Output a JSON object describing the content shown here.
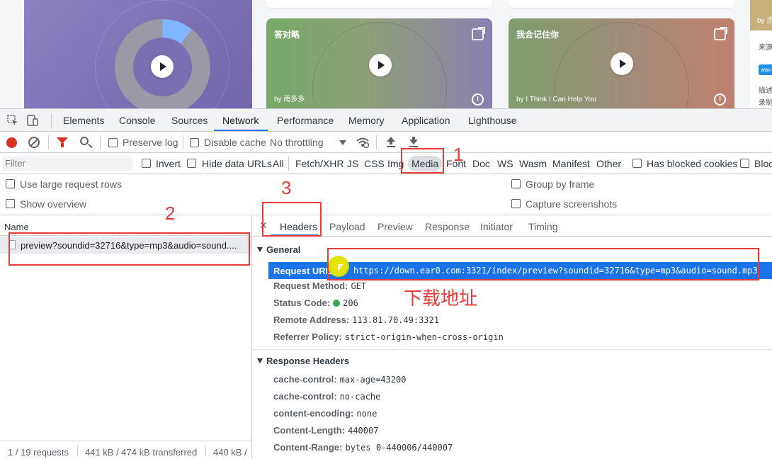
{
  "page": {
    "cards": [
      {
        "title": "",
        "author": ""
      },
      {
        "title": "答对略",
        "author": "by 雨多多"
      },
      {
        "title": "我会记住你",
        "author": "by I Think I Can Help You"
      }
    ],
    "side": {
      "top_text": "by 杰",
      "line1": "来源",
      "badge": "wav",
      "line2": "描述",
      "line3": "录制"
    }
  },
  "devtools": {
    "tabs": [
      "Elements",
      "Console",
      "Sources",
      "Network",
      "Performance",
      "Memory",
      "Application",
      "Lighthouse"
    ],
    "active_tab": "Network",
    "toolbar": {
      "preserve_log": "Preserve log",
      "disable_cache": "Disable cache",
      "throttling": "No throttling"
    },
    "filter": {
      "placeholder": "Filter",
      "invert": "Invert",
      "hide_data_urls": "Hide data URLs",
      "types": [
        "All",
        "Fetch/XHR",
        "JS",
        "CSS",
        "Img",
        "Media",
        "Font",
        "Doc",
        "WS",
        "Wasm",
        "Manifest",
        "Other"
      ],
      "active_type": "Media",
      "has_blocked_cookies": "Has blocked cookies",
      "blocked_requests": "Bloc"
    },
    "options": {
      "large_rows": "Use large request rows",
      "group_by_frame": "Group by frame",
      "show_overview": "Show overview",
      "capture_screenshots": "Capture screenshots"
    },
    "list": {
      "header": "Name",
      "rows": [
        "preview?soundid=32716&type=mp3&audio=sound...."
      ]
    },
    "status": {
      "requests": "1 / 19 requests",
      "transferred": "441 kB / 474 kB transferred",
      "resources": "440 kB /"
    },
    "detail_tabs": [
      "Headers",
      "Payload",
      "Preview",
      "Response",
      "Initiator",
      "Timing"
    ],
    "active_detail_tab": "Headers",
    "general": {
      "title": "General",
      "request_url_key": "Request URL:",
      "request_url": "https://down.ear0.com:3321/index/preview?soundid=32716&type=mp3&audio=sound.mp3",
      "request_method_key": "Request Method:",
      "request_method": "GET",
      "status_code_key": "Status Code:",
      "status_code": "206",
      "remote_address_key": "Remote Address:",
      "remote_address": "113.81.70.49:3321",
      "referrer_policy_key": "Referrer Policy:",
      "referrer_policy": "strict-origin-when-cross-origin"
    },
    "response_headers": {
      "title": "Response Headers",
      "items": [
        {
          "k": "cache-control:",
          "v": "max-age=43200"
        },
        {
          "k": "cache-control:",
          "v": "no-cache"
        },
        {
          "k": "content-encoding:",
          "v": "none"
        },
        {
          "k": "Content-Length:",
          "v": "440007"
        },
        {
          "k": "Content-Range:",
          "v": "bytes 0-440006/440007"
        }
      ]
    }
  },
  "annotations": {
    "n1": "1",
    "n2": "2",
    "n3": "3",
    "download_label": "下载地址"
  },
  "colors": {
    "accent": "#1a73e8",
    "annotation_red": "#ea3b3b",
    "record_red": "#d93025",
    "status_green": "#34a853"
  }
}
